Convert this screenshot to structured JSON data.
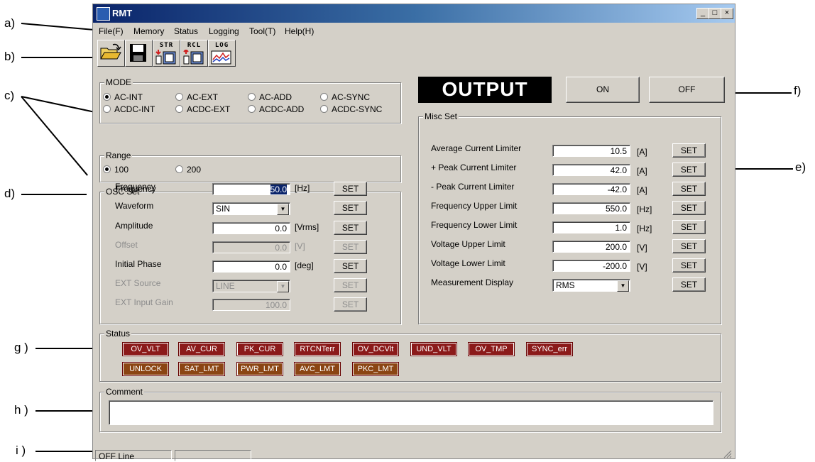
{
  "annotations": {
    "a": "a)",
    "b": "b)",
    "c": "c)",
    "d": "d)",
    "e": "e)",
    "f": "f)",
    "g": "g )",
    "h": "h )",
    "i": "i )"
  },
  "window": {
    "title": "RMT",
    "controls": {
      "minimize": "_",
      "maximize": "□",
      "close": "×"
    }
  },
  "menu": [
    "File(F)",
    "Memory",
    "Status",
    "Logging",
    "Tool(T)",
    "Help(H)"
  ],
  "toolbar": {
    "open_icon": "folder-open-icon",
    "save_icon": "floppy-disk-icon",
    "str_label": "STR",
    "rcl_label": "RCL",
    "log_label": "LOG"
  },
  "mode": {
    "title": "MODE",
    "options": [
      "AC-INT",
      "AC-EXT",
      "AC-ADD",
      "AC-SYNC",
      "ACDC-INT",
      "ACDC-EXT",
      "ACDC-ADD",
      "ACDC-SYNC"
    ],
    "selected": "AC-INT"
  },
  "range": {
    "title": "Range",
    "options": [
      "100",
      "200"
    ],
    "selected": "100"
  },
  "osc": {
    "title": "OSC Set",
    "set_label": "SET",
    "rows": [
      {
        "label": "Frequency",
        "value": "50.0",
        "unit": "[Hz]",
        "enabled": true,
        "type": "field"
      },
      {
        "label": "Waveform",
        "value": "SIN",
        "unit": "",
        "enabled": true,
        "type": "combo"
      },
      {
        "label": "Amplitude",
        "value": "0.0",
        "unit": "[Vrms]",
        "enabled": true,
        "type": "field"
      },
      {
        "label": "Offset",
        "value": "0.0",
        "unit": "[V]",
        "enabled": false,
        "type": "field"
      },
      {
        "label": "Initial Phase",
        "value": "0.0",
        "unit": "[deg]",
        "enabled": true,
        "type": "field"
      },
      {
        "label": "EXT Source",
        "value": "LINE",
        "unit": "",
        "enabled": false,
        "type": "combo"
      },
      {
        "label": "EXT Input Gain",
        "value": "100.0",
        "unit": "",
        "enabled": false,
        "type": "field"
      }
    ]
  },
  "output": {
    "label": "OUTPUT",
    "on_label": "ON",
    "off_label": "OFF"
  },
  "misc": {
    "title": "Misc Set",
    "set_label": "SET",
    "rows": [
      {
        "label": "Average Current Limiter",
        "value": "10.5",
        "unit": "[A]",
        "type": "field"
      },
      {
        "label": "+ Peak Current Limiter",
        "value": "42.0",
        "unit": "[A]",
        "type": "field"
      },
      {
        "label": "- Peak Current Limiter",
        "value": "-42.0",
        "unit": "[A]",
        "type": "field"
      },
      {
        "label": "Frequency Upper Limit",
        "value": "550.0",
        "unit": "[Hz]",
        "type": "field"
      },
      {
        "label": "Frequency Lower Limit",
        "value": "1.0",
        "unit": "[Hz]",
        "type": "field"
      },
      {
        "label": "Voltage Upper Limit",
        "value": "200.0",
        "unit": "[V]",
        "type": "field"
      },
      {
        "label": "Voltage Lower Limit",
        "value": "-200.0",
        "unit": "[V]",
        "type": "field"
      },
      {
        "label": "Measurement Display",
        "value": "RMS",
        "unit": "",
        "type": "combo"
      }
    ]
  },
  "status": {
    "title": "Status",
    "row1": [
      {
        "label": "OV_VLT",
        "color": "#8b1a1a"
      },
      {
        "label": "AV_CUR",
        "color": "#8b1a1a"
      },
      {
        "label": "PK_CUR",
        "color": "#8b1a1a"
      },
      {
        "label": "RTCNTerr",
        "color": "#8b1a1a"
      },
      {
        "label": "OV_DCVlt",
        "color": "#8b1a1a"
      },
      {
        "label": "UND_VLT",
        "color": "#8b1a1a"
      },
      {
        "label": "OV_TMP",
        "color": "#8b1a1a"
      },
      {
        "label": "SYNC_err",
        "color": "#8b1a1a"
      }
    ],
    "row2": [
      {
        "label": "UNLOCK",
        "color": "#8b4513"
      },
      {
        "label": "SAT_LMT",
        "color": "#8b4513"
      },
      {
        "label": "PWR_LMT",
        "color": "#8b4513"
      },
      {
        "label": "AVC_LMT",
        "color": "#8b4513"
      },
      {
        "label": "PKC_LMT",
        "color": "#8b4513"
      }
    ]
  },
  "comment": {
    "title": "Comment",
    "value": ""
  },
  "statusbar": {
    "line_status": "OFF Line",
    "second": ""
  }
}
